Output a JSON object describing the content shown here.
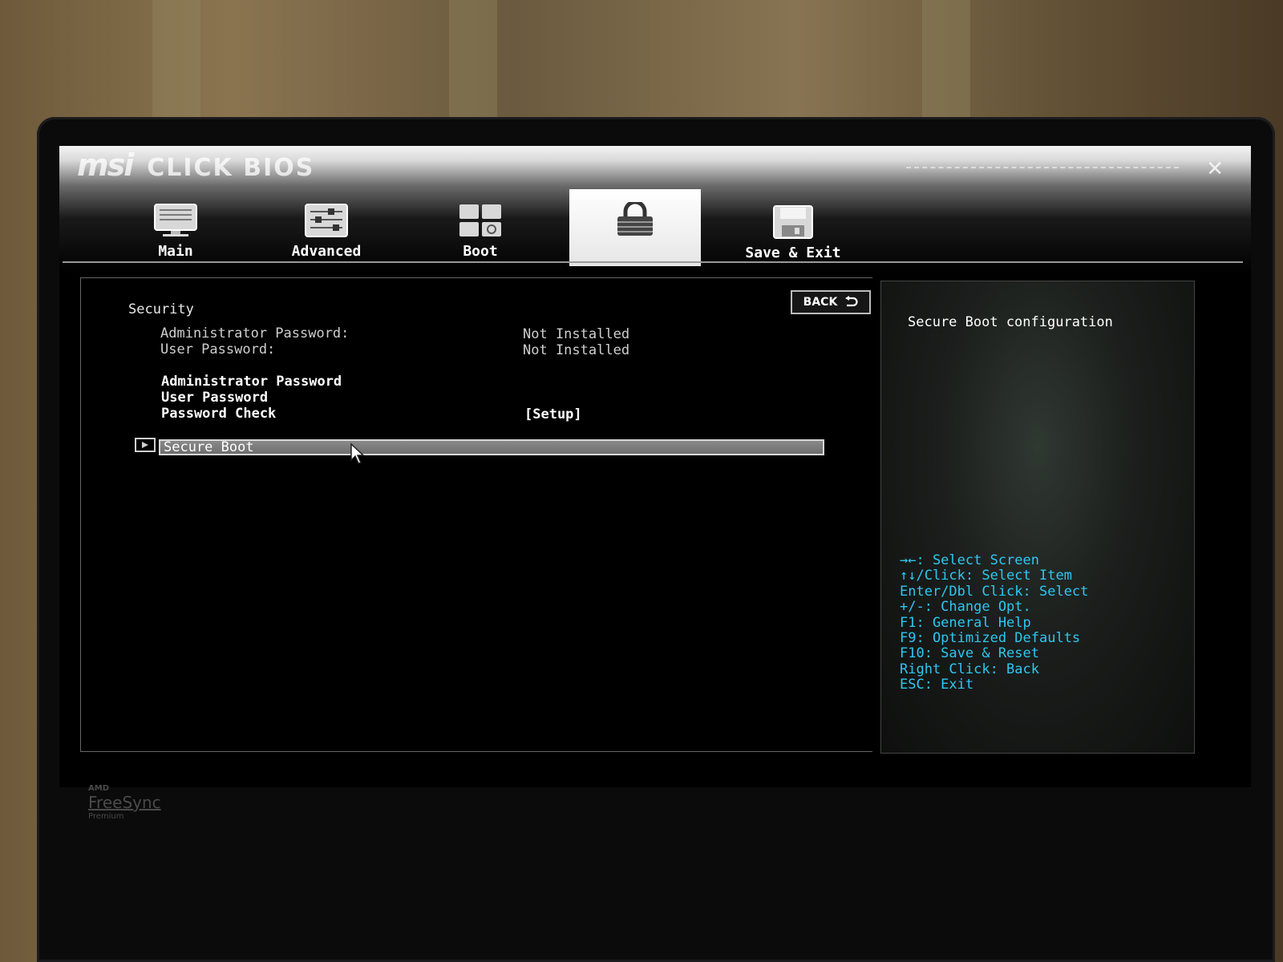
{
  "brand": {
    "logo": "msi",
    "name": "CLICK BIOS"
  },
  "tabs": [
    {
      "label": "Main",
      "icon": "monitor-icon"
    },
    {
      "label": "Advanced",
      "icon": "sliders-icon"
    },
    {
      "label": "Boot",
      "icon": "boot-icon"
    },
    {
      "label": "",
      "icon": "lock-icon",
      "active": true
    },
    {
      "label": "Save & Exit",
      "icon": "floppy-icon"
    }
  ],
  "content": {
    "section_title": "Security",
    "back_label": "BACK",
    "info_rows": [
      {
        "label": "Administrator Password:",
        "value": "Not Installed"
      },
      {
        "label": "User Password:",
        "value": "Not Installed"
      }
    ],
    "items": [
      {
        "label": "Administrator Password",
        "value": ""
      },
      {
        "label": "User Password",
        "value": ""
      },
      {
        "label": "Password Check",
        "value": "[Setup]"
      }
    ],
    "submenu": {
      "label": "Secure Boot"
    }
  },
  "help": {
    "description": "Secure Boot configuration",
    "keys": [
      "→←: Select Screen",
      "↑↓/Click: Select Item",
      "Enter/Dbl Click: Select",
      "+/-: Change Opt.",
      "F1: General Help",
      "F9: Optimized Defaults",
      "F10: Save & Reset",
      "Right Click: Back",
      "ESC: Exit"
    ]
  },
  "bezel": {
    "amd": "AMD",
    "freesync": "FreeSync",
    "premium": "Premium"
  },
  "colors": {
    "accent": "#2ec7f0",
    "selection": "#7a7a7a"
  }
}
